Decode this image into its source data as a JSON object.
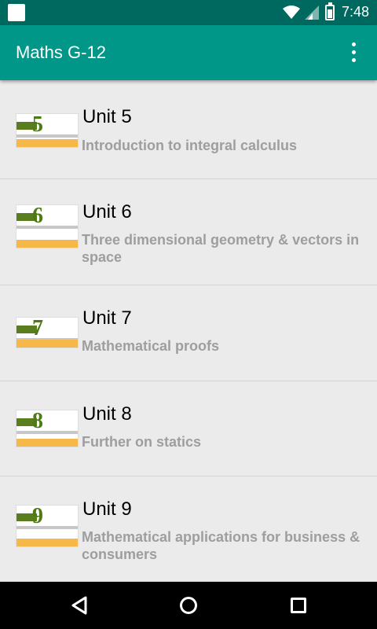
{
  "status_bar": {
    "time": "7:48"
  },
  "app_bar": {
    "title": "Maths G-12"
  },
  "units": [
    {
      "title": "Unit 5",
      "subtitle": "Introduction to integral calculus",
      "thumb_number": "5"
    },
    {
      "title": "Unit 6",
      "subtitle": "Three dimensional geometry & vectors in space",
      "thumb_number": "6"
    },
    {
      "title": "Unit 7",
      "subtitle": "Mathematical proofs",
      "thumb_number": "7"
    },
    {
      "title": "Unit 8",
      "subtitle": "Further on statics",
      "thumb_number": "8"
    },
    {
      "title": "Unit 9",
      "subtitle": "Mathematical applications for business & consumers",
      "thumb_number": "9"
    }
  ],
  "colors": {
    "status_bar": "#00695f",
    "app_bar": "#009688",
    "list_bg": "#ebebeb",
    "subtitle": "#9e9e9e"
  },
  "icons": {
    "menu": "overflow-menu-icon",
    "back": "back-triangle-icon",
    "home": "home-circle-icon",
    "recent": "recent-apps-square-icon"
  }
}
